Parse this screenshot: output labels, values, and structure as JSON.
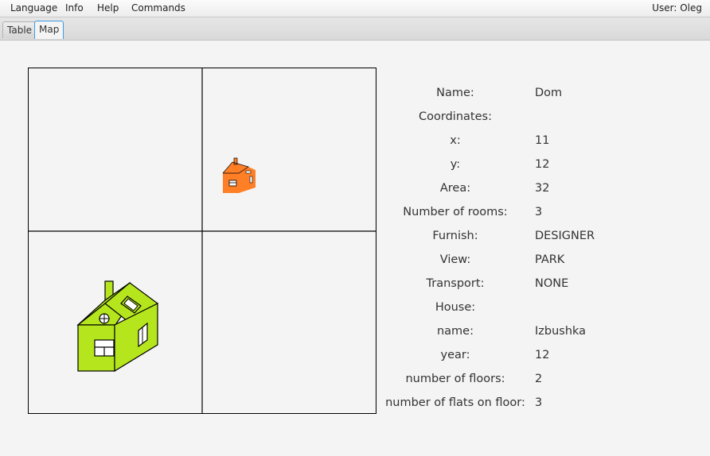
{
  "menu": {
    "language": "Language",
    "info": "Info",
    "help": "Help",
    "commands": "Commands"
  },
  "user_label": "User: Oleg",
  "tabs": {
    "table": "Table",
    "map": "Map",
    "selected": "Map"
  },
  "map": {
    "houses": [
      {
        "name": "small-house",
        "color": "#ff7f27"
      },
      {
        "name": "large-house",
        "color": "#b5e61d"
      }
    ]
  },
  "details": [
    {
      "label": "Name:",
      "value": "Dom"
    },
    {
      "label": "Coordinates:",
      "value": ""
    },
    {
      "label": "x:",
      "value": "11"
    },
    {
      "label": "y:",
      "value": "12"
    },
    {
      "label": "Area:",
      "value": "32"
    },
    {
      "label": "Number of rooms:",
      "value": "3"
    },
    {
      "label": "Furnish:",
      "value": "DESIGNER"
    },
    {
      "label": "View:",
      "value": "PARK"
    },
    {
      "label": "Transport:",
      "value": "NONE"
    },
    {
      "label": "House:",
      "value": ""
    },
    {
      "label": "name:",
      "value": "Izbushka"
    },
    {
      "label": "year:",
      "value": "12"
    },
    {
      "label": "number of floors:",
      "value": "2"
    },
    {
      "label": "number of flats on floor:",
      "value": "3"
    }
  ]
}
